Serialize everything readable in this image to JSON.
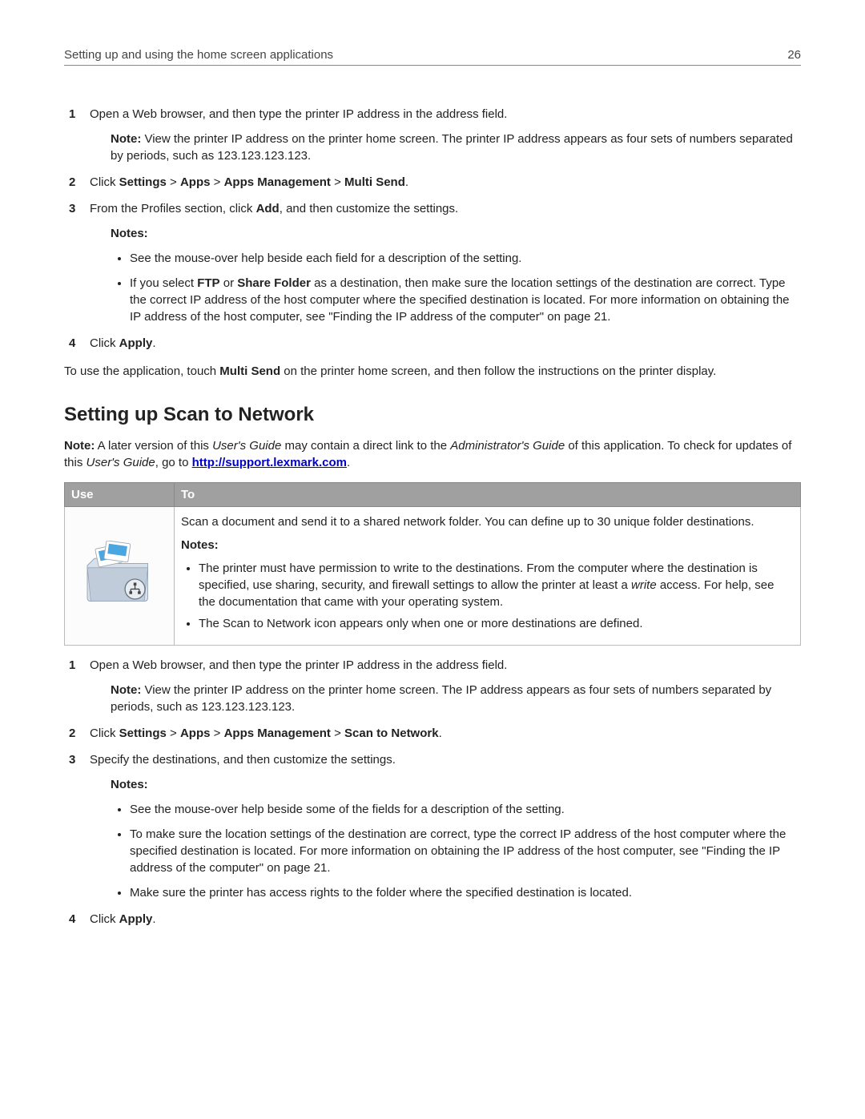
{
  "header": {
    "title": "Setting up and using the home screen applications",
    "page": "26"
  },
  "top": {
    "step1": "Open a Web browser, and then type the printer IP address in the address field.",
    "step1_note_label": "Note:",
    "step1_note": " View the printer IP address on the printer home screen. The printer IP address appears as four sets of numbers separated by periods, such as 123.123.123.123.",
    "step2_pre": " Click ",
    "step2_b1": "Settings",
    "step2_b2": "Apps",
    "step2_b3": "Apps Management",
    "step2_b4": "Multi Send",
    "gt": " > ",
    "step3_pre": "From the Profiles section, click ",
    "step3_add": "Add",
    "step3_post": ", and then customize the settings.",
    "notes_label": "Notes:",
    "bullet_a": "See the mouse-over help beside each field for a description of the setting.",
    "bullet_b_pre": "If you select ",
    "bullet_b_ftp": "FTP",
    "bullet_b_or": " or ",
    "bullet_b_share": "Share Folder",
    "bullet_b_post": " as a destination, then make sure the location settings of the destination are correct. Type the correct IP address of the host computer where the specified destination is located. For more information on obtaining the IP address of the host computer, see \"Finding the IP address of the computer\" on page 21.",
    "step4_pre": " Click ",
    "step4_apply": "Apply",
    "after_steps_pre": "To use the application, touch ",
    "after_steps_ms": "Multi Send",
    "after_steps_post": " on the printer home screen, and then follow the instructions on the printer display."
  },
  "section2": {
    "heading": "Setting up Scan to Network",
    "note_label": "Note:",
    "note_pre": " A later version of this ",
    "note_ug": "User's Guide",
    "note_mid": " may contain a direct link to the ",
    "note_ag": "Administrator's Guide",
    "note_mid2": " of this application. To check for updates of this ",
    "note_goto": ", go to ",
    "link_text": "http://support.lexmark.com",
    "link_post": ".",
    "table": {
      "h_use": "Use",
      "h_to": "To",
      "desc": "Scan a document and send it to a shared network folder. You can define up to 30 unique folder destinations.",
      "notes_label": "Notes:",
      "b1_pre": "The printer must have permission to write to the destinations. From the computer where the destination is specified, use sharing, security, and firewall settings to allow the printer at least a ",
      "b1_write": "write",
      "b1_post": " access. For help, see the documentation that came with your operating system.",
      "b2": "The Scan to Network icon appears only when one or more destinations are defined."
    },
    "steps": {
      "s1": "Open a Web browser, and then type the printer IP address in the address field.",
      "s1_note_label": "Note:",
      "s1_note": " View the printer IP address on the printer home screen. The IP address appears as four sets of numbers separated by periods, such as 123.123.123.123.",
      "s2_pre": " Click ",
      "s2_b1": "Settings",
      "s2_b2": "Apps",
      "s2_b3": "Apps Management",
      "s2_b4": "Scan to Network",
      "s3": "Specify the destinations, and then customize the settings.",
      "notes_label": "Notes:",
      "nb1": "See the mouse-over help beside some of the fields for a description of the setting.",
      "nb2": "To make sure the location settings of the destination are correct, type the correct IP address of the host computer where the specified destination is located. For more information on obtaining the IP address of the host computer, see \"Finding the IP address of the computer\" on page 21.",
      "nb3": "Make sure the printer has access rights to the folder where the specified destination is located.",
      "s4_pre": " Click ",
      "s4_apply": "Apply"
    }
  },
  "nums": {
    "n1": "1",
    "n2": "2",
    "n3": "3",
    "n4": "4"
  }
}
